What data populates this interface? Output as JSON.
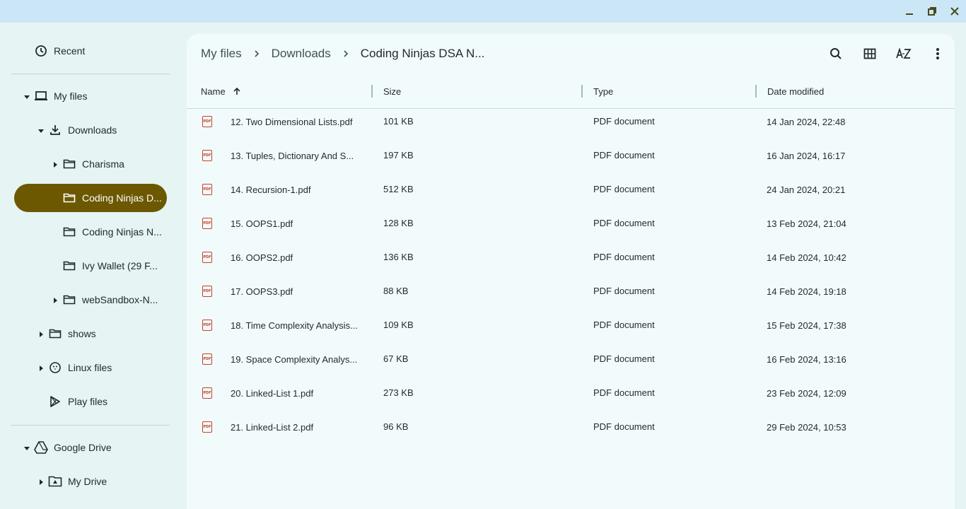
{
  "window": {
    "minimize_icon": "minimize-icon",
    "maximize_icon": "maximize-icon",
    "close_icon": "close-icon"
  },
  "sidebar": {
    "recent": "Recent",
    "my_files": "My files",
    "downloads": "Downloads",
    "folders": [
      {
        "label": "Charisma",
        "expandable": true
      },
      {
        "label": "Coding Ninjas D...",
        "expandable": false,
        "selected": true
      },
      {
        "label": "Coding Ninjas N...",
        "expandable": false
      },
      {
        "label": "Ivy Wallet (29 F...",
        "expandable": false
      },
      {
        "label": "webSandbox-N...",
        "expandable": true
      }
    ],
    "shows": "shows",
    "linux_files": "Linux files",
    "play_files": "Play files",
    "google_drive": "Google Drive",
    "my_drive": "My Drive"
  },
  "breadcrumb": {
    "items": [
      "My files",
      "Downloads",
      "Coding Ninjas DSA N..."
    ]
  },
  "toolbar": {
    "search_icon": "search-icon",
    "grid_icon": "grid-view-icon",
    "sort_icon": "sort-az-icon",
    "more_icon": "more-vert-icon"
  },
  "columns": {
    "name": "Name",
    "size": "Size",
    "type": "Type",
    "date": "Date modified"
  },
  "files": [
    {
      "name": "12. Two Dimensional Lists.pdf",
      "size": "101 KB",
      "type": "PDF document",
      "date": "14 Jan 2024, 22:48"
    },
    {
      "name": "13. Tuples, Dictionary And S...",
      "size": "197 KB",
      "type": "PDF document",
      "date": "16 Jan 2024, 16:17"
    },
    {
      "name": "14. Recursion-1.pdf",
      "size": "512 KB",
      "type": "PDF document",
      "date": "24 Jan 2024, 20:21"
    },
    {
      "name": "15. OOPS1.pdf",
      "size": "128 KB",
      "type": "PDF document",
      "date": "13 Feb 2024, 21:04"
    },
    {
      "name": "16. OOPS2.pdf",
      "size": "136 KB",
      "type": "PDF document",
      "date": "14 Feb 2024, 10:42"
    },
    {
      "name": "17. OOPS3.pdf",
      "size": "88 KB",
      "type": "PDF document",
      "date": "14 Feb 2024, 19:18"
    },
    {
      "name": "18. Time Complexity Analysis...",
      "size": "109 KB",
      "type": "PDF document",
      "date": "15 Feb 2024, 17:38"
    },
    {
      "name": "19. Space Complexity Analys...",
      "size": "67 KB",
      "type": "PDF document",
      "date": "16 Feb 2024, 13:16"
    },
    {
      "name": "20. Linked-List 1.pdf",
      "size": "273 KB",
      "type": "PDF document",
      "date": "23 Feb 2024, 12:09"
    },
    {
      "name": "21. Linked-List 2.pdf",
      "size": "96 KB",
      "type": "PDF document",
      "date": "29 Feb 2024, 10:53"
    }
  ],
  "file_icon_text": "PDF",
  "colors": {
    "selected": "#6b5800",
    "pdf": "#c8402a"
  }
}
